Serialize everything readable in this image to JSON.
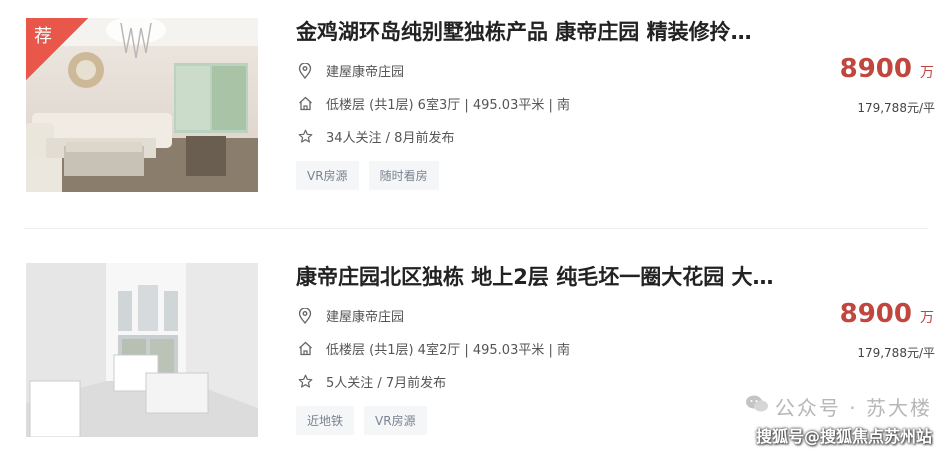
{
  "listings": [
    {
      "title": "金鸡湖环岛纯别墅独栋产品 康帝庄园 精装修拎…",
      "community": "建屋康帝庄园",
      "details": "低楼层 (共1层) 6室3厅 | 495.03平米 | 南",
      "meta": "34人关注 / 8月前发布",
      "tags": [
        "VR房源",
        "随时看房"
      ],
      "price": "8900",
      "price_unit": "万",
      "unit_price": "179,788元/平",
      "badge": "荐"
    },
    {
      "title": "康帝庄园北区独栋 地上2层 纯毛坯一圈大花园 大…",
      "community": "建屋康帝庄园",
      "details": "低楼层 (共1层) 4室2厅 | 495.03平米 | 南",
      "meta": "5人关注 / 7月前发布",
      "tags": [
        "近地铁",
        "VR房源"
      ],
      "price": "8900",
      "price_unit": "万",
      "unit_price": "179,788元/平"
    }
  ],
  "watermark": {
    "line1": "公众号 · 苏大楼",
    "line2": "搜狐号@搜狐焦点苏州站"
  },
  "icons": [
    "location-icon",
    "house-icon",
    "star-icon",
    "wechat-icon"
  ]
}
